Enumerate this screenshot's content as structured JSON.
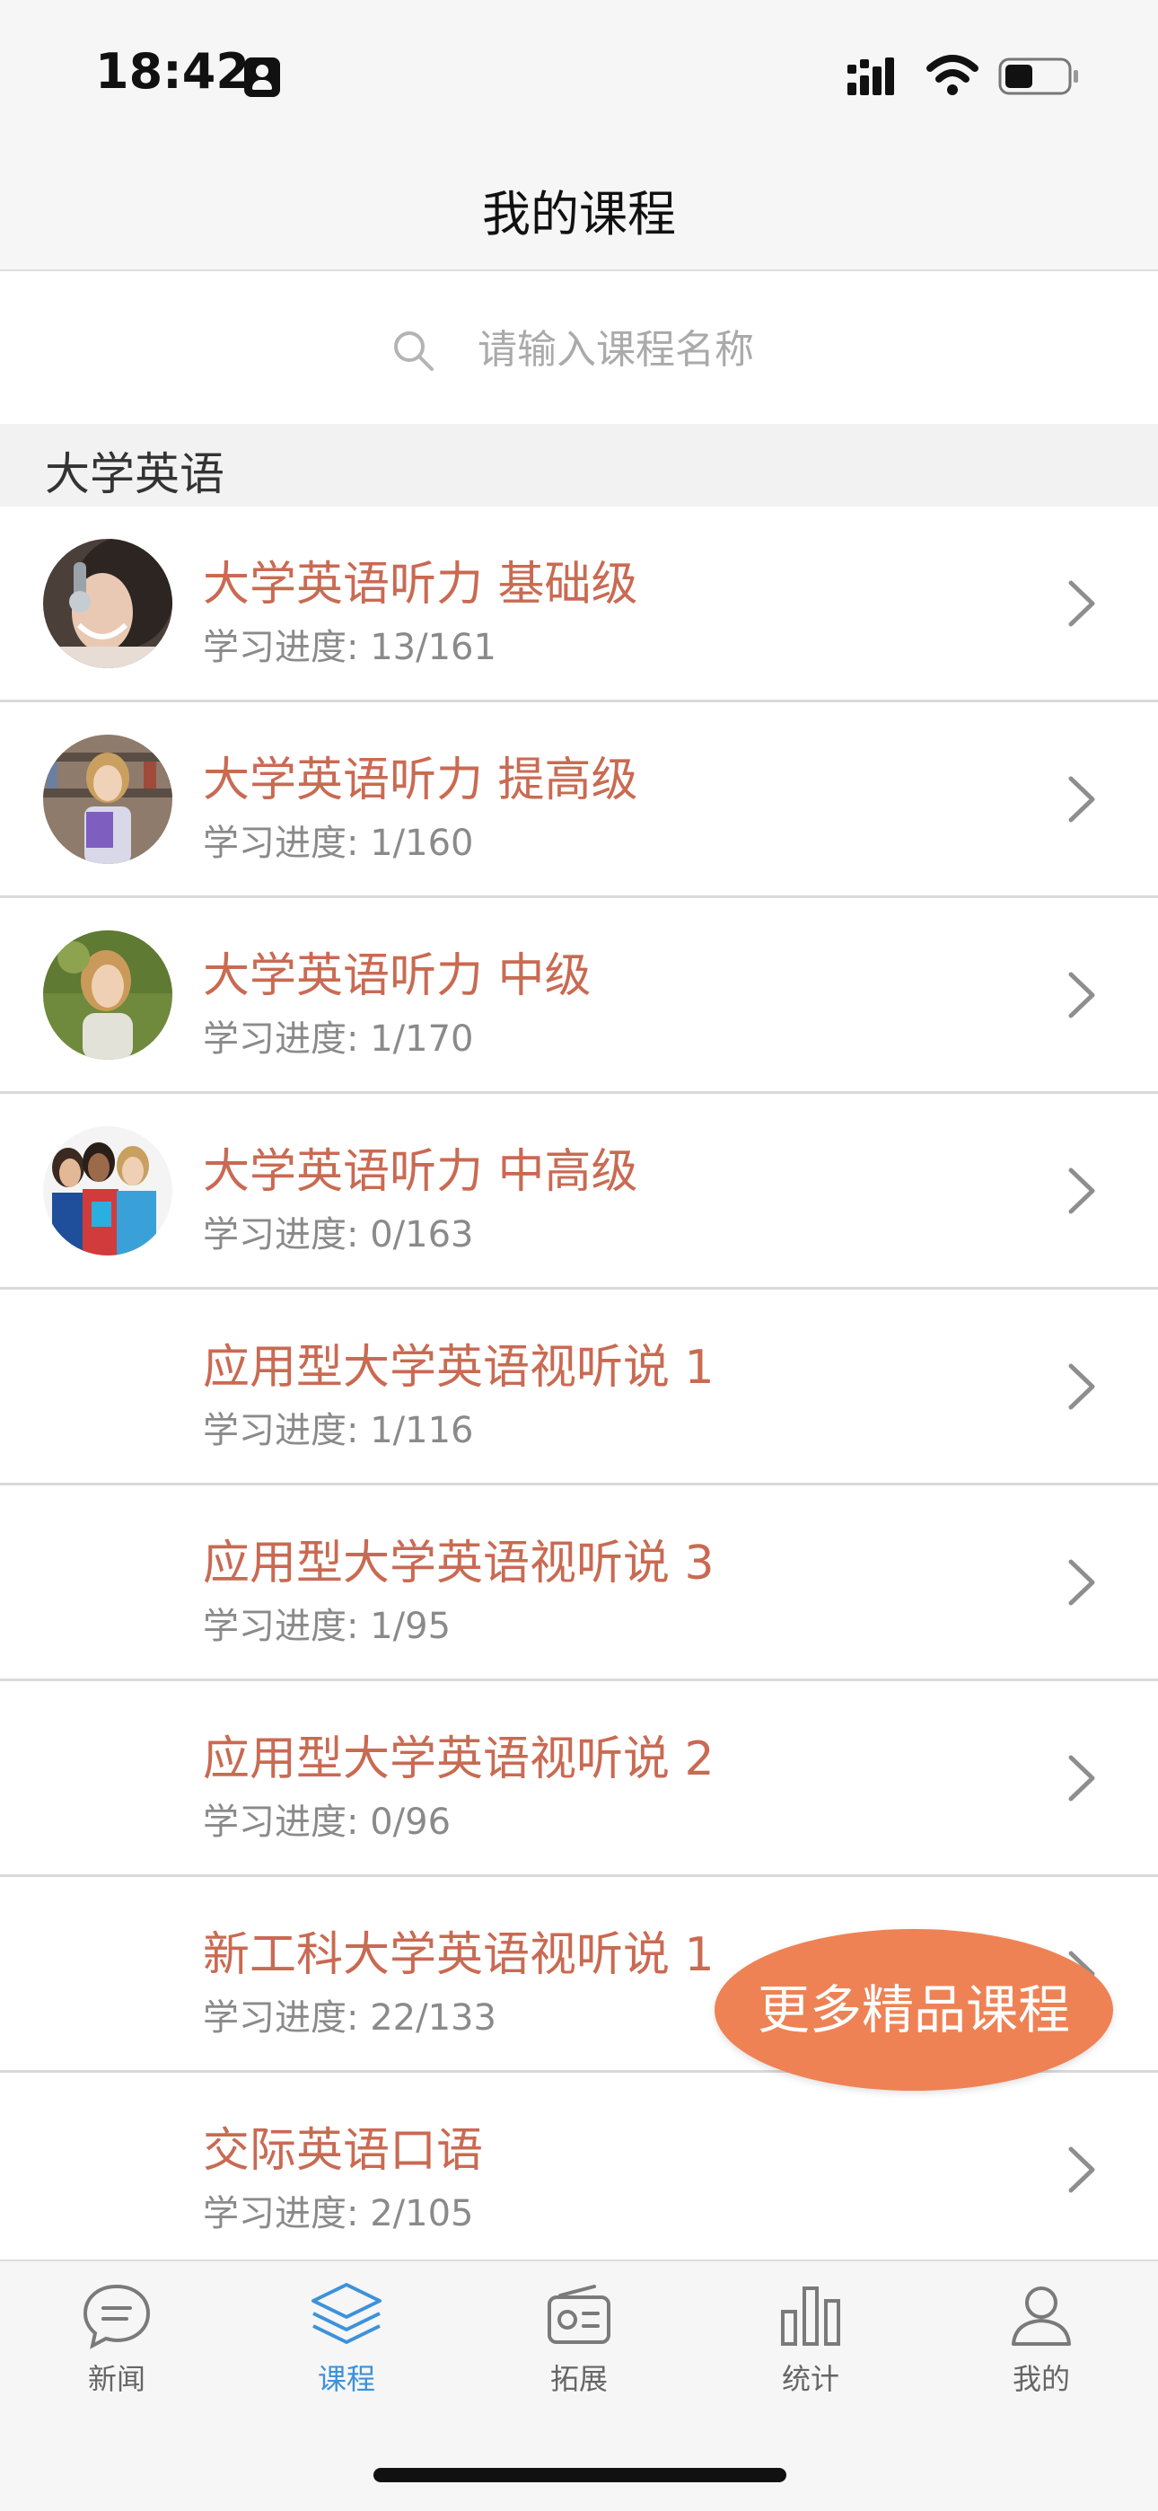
{
  "status": {
    "time": "18:42"
  },
  "nav": {
    "title": "我的课程"
  },
  "search": {
    "placeholder": "请输入课程名称"
  },
  "section": {
    "title": "大学英语"
  },
  "courses": [
    {
      "title": "大学英语听力 基础级",
      "progress": "学习进度: 13/161",
      "thumb": "headphones-woman-photo"
    },
    {
      "title": "大学英语听力 提高级",
      "progress": "学习进度: 1/160",
      "thumb": "library-student-photo"
    },
    {
      "title": "大学英语听力 中级",
      "progress": "学习进度: 1/170",
      "thumb": "outdoor-woman-photo"
    },
    {
      "title": "大学英语听力 中高级",
      "progress": "学习进度: 0/163",
      "thumb": "student-group-photo"
    },
    {
      "title": "应用型大学英语视听说 1",
      "progress": "学习进度: 1/116"
    },
    {
      "title": "应用型大学英语视听说 3",
      "progress": "学习进度: 1/95"
    },
    {
      "title": "应用型大学英语视听说 2",
      "progress": "学习进度: 0/96"
    },
    {
      "title": "新工科大学英语视听说 1",
      "progress": "学习进度: 22/133"
    },
    {
      "title": "交际英语口语",
      "progress": "学习进度: 2/105"
    }
  ],
  "more_button": {
    "label": "更多精品课程"
  },
  "tabs": [
    {
      "label": "新闻",
      "icon": "chat-bubble-icon",
      "active": false
    },
    {
      "label": "课程",
      "icon": "layers-icon",
      "active": true
    },
    {
      "label": "拓展",
      "icon": "radio-icon",
      "active": false
    },
    {
      "label": "统计",
      "icon": "bar-chart-icon",
      "active": false
    },
    {
      "label": "我的",
      "icon": "user-icon",
      "active": false
    }
  ],
  "colors": {
    "course_title": "#c96a52",
    "progress_text": "#8a8a8a",
    "more_button_bg": "#ee8255",
    "active_tab": "#3d92d9",
    "inactive_tab": "#666666"
  }
}
